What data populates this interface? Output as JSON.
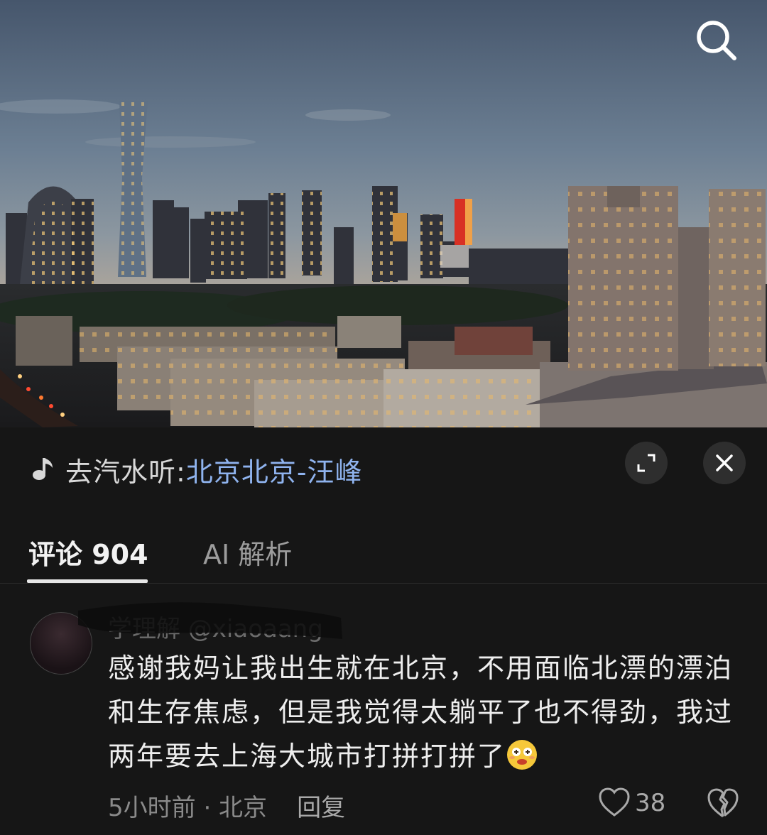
{
  "music": {
    "prefix": "去汽水听:",
    "song": "北京北京-汪峰"
  },
  "tabs": [
    {
      "label": "评论 904",
      "active": true
    },
    {
      "label": "AI 解析",
      "active": false
    }
  ],
  "comment": {
    "username": "学理解 @xiaoaang",
    "text": "感谢我妈让我出生就在北京，不用面临北漂的漂泊和生存焦虑，但是我觉得太躺平了也不得劲，我过两年要去上海大城市打拼打拼了",
    "time_location": "5小时前 · 北京",
    "reply_label": "回复",
    "like_count": "38",
    "emoji": "dizzy-face-emoji"
  },
  "icons": {
    "search": "search-icon",
    "note": "music-note-icon",
    "expand": "expand-icon",
    "close": "close-icon",
    "like": "heart-icon",
    "dislike": "broken-heart-icon"
  },
  "colors": {
    "background": "#161616",
    "song_link": "#8fb3ee",
    "text_primary": "#eeeeee",
    "text_muted": "#8a8a8a"
  }
}
